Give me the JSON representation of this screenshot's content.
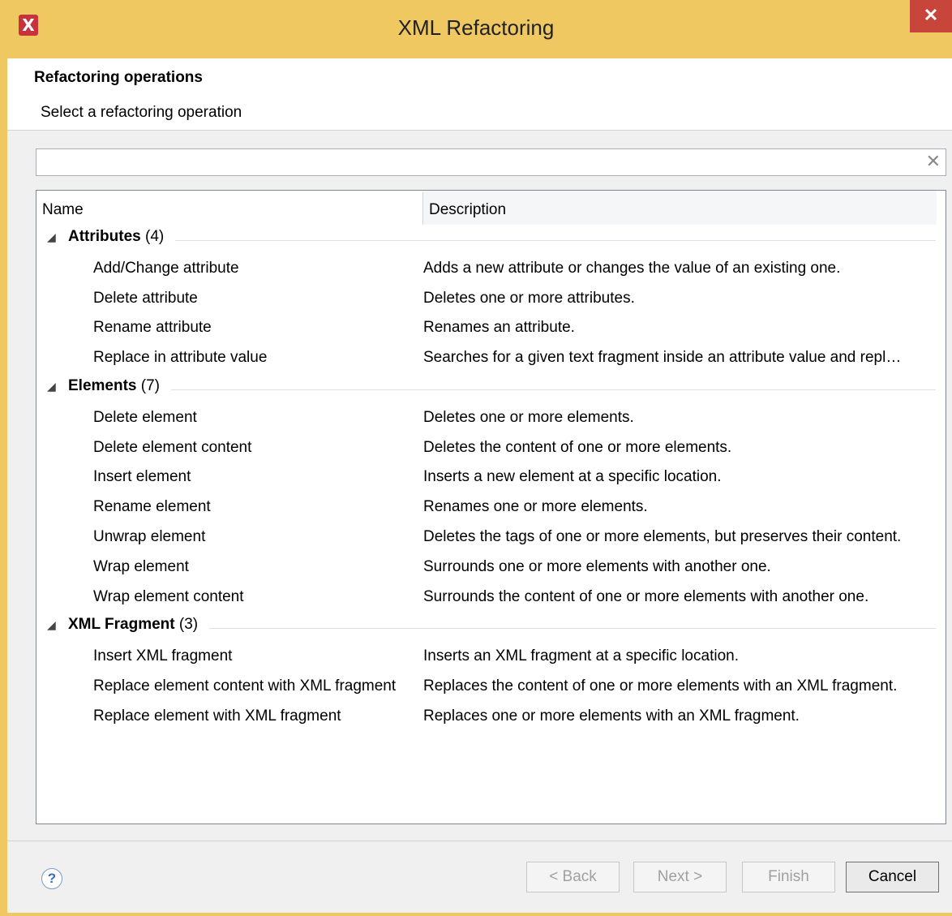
{
  "window": {
    "title": "XML Refactoring",
    "close_glyph": "✕",
    "app_icon": "X"
  },
  "header": {
    "title": "Refactoring operations",
    "subtitle": "Select a refactoring operation"
  },
  "search": {
    "value": "",
    "clear_glyph": "✕"
  },
  "table": {
    "columns": [
      "Name",
      "Description"
    ],
    "groups": [
      {
        "label": "Attributes",
        "count": "(4)",
        "items": [
          {
            "name": "Add/Change attribute",
            "description": "Adds a new attribute or changes the value of an existing one."
          },
          {
            "name": "Delete attribute",
            "description": "Deletes one or more attributes."
          },
          {
            "name": "Rename attribute",
            "description": "Renames an attribute."
          },
          {
            "name": "Replace in attribute value",
            "description": "Searches for a given text fragment inside an attribute value and repl…"
          }
        ]
      },
      {
        "label": "Elements",
        "count": "(7)",
        "items": [
          {
            "name": "Delete element",
            "description": "Deletes one or more elements."
          },
          {
            "name": "Delete element content",
            "description": "Deletes the content of one or more elements."
          },
          {
            "name": "Insert element",
            "description": "Inserts a new element at a specific location."
          },
          {
            "name": "Rename element",
            "description": "Renames one or more elements."
          },
          {
            "name": "Unwrap element",
            "description": "Deletes the tags of one or more elements, but preserves their content."
          },
          {
            "name": "Wrap element",
            "description": "Surrounds one or more elements with another one."
          },
          {
            "name": "Wrap element content",
            "description": "Surrounds the content of one or more elements with another one."
          }
        ]
      },
      {
        "label": "XML Fragment",
        "count": "(3)",
        "items": [
          {
            "name": "Insert XML fragment",
            "description": "Inserts an XML fragment at a specific location."
          },
          {
            "name": "Replace element content with XML fragment",
            "description": "Replaces the content of one or more elements with an XML fragment."
          },
          {
            "name": "Replace element with XML fragment",
            "description": "Replaces one or more elements with an XML fragment."
          }
        ]
      }
    ]
  },
  "footer": {
    "help_glyph": "?",
    "back_label": "< Back",
    "next_label": "Next >",
    "finish_label": "Finish",
    "cancel_label": "Cancel"
  },
  "colors": {
    "titlebar": "#f0c862",
    "close": "#c7453a"
  }
}
